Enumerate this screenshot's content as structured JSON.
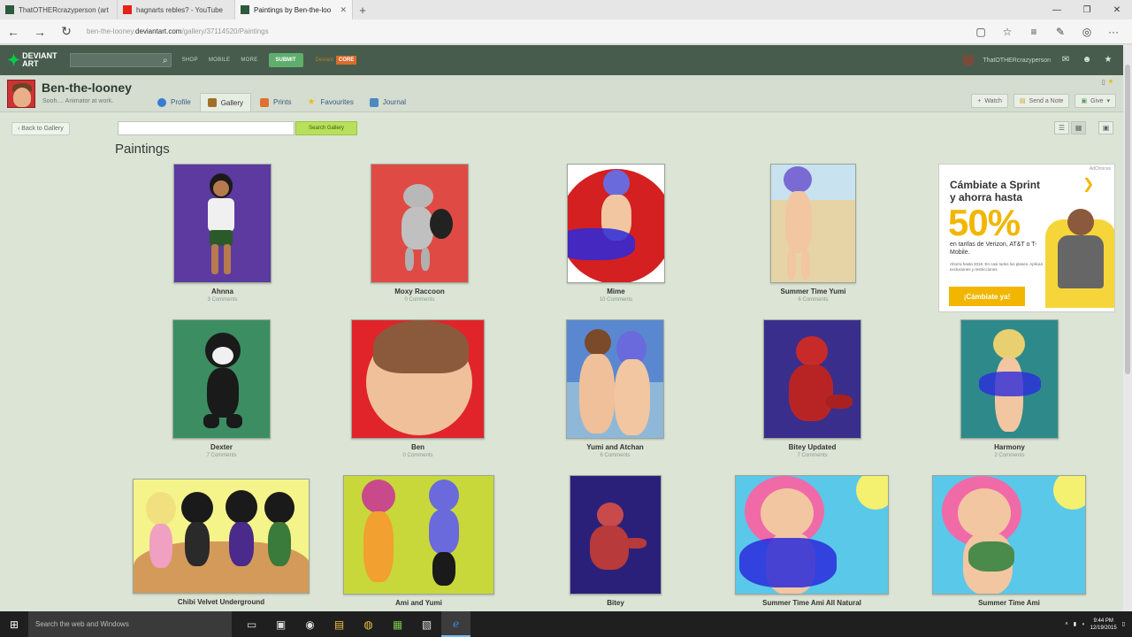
{
  "browser": {
    "tabs": [
      {
        "label": "ThatOTHERcrazyperson (art",
        "favicon_color": "#2d5a3c",
        "active": false
      },
      {
        "label": "hagnarts rebles? - YouTube",
        "favicon_color": "#e62117",
        "active": false
      },
      {
        "label": "Paintings by Ben-the-loo",
        "favicon_color": "#2d5a3c",
        "active": true
      }
    ],
    "new_tab": "+",
    "url_prefix": "ben-the-looney.",
    "url_domain": "deviantart.com",
    "url_suffix": "/gallery/37114520/Paintings"
  },
  "da": {
    "logo_line1": "DEVIANT",
    "logo_line2": "ART",
    "nav": [
      "SHOP",
      "MOBILE",
      "MORE"
    ],
    "submit": "SUBMIT",
    "core_prefix": "Deviant",
    "core_badge": "CORE",
    "username": "ThatOTHERcrazyperson"
  },
  "profile": {
    "name": "Ben-the-looney",
    "tagline": "Sooh.... Animator at work.",
    "tabs": [
      {
        "label": "Profile",
        "icon_color": "#3a7bd5"
      },
      {
        "label": "Gallery",
        "icon_color": "#a0702a"
      },
      {
        "label": "Prints",
        "icon_color": "#e07030"
      },
      {
        "label": "Favourites",
        "icon_color": "#e8c020"
      },
      {
        "label": "Journal",
        "icon_color": "#4a8ac0"
      }
    ],
    "actions": [
      "Watch",
      "Send a Note",
      "Give"
    ]
  },
  "gallery": {
    "back": "Back to Gallery",
    "search_btn": "Search Gallery",
    "section_title": "Paintings",
    "items": [
      {
        "title": "Ahnna",
        "comments": "3 Comments"
      },
      {
        "title": "Moxy Raccoon",
        "comments": "0 Comments"
      },
      {
        "title": "Mime",
        "comments": "10 Comments"
      },
      {
        "title": "Summer Time Yumi",
        "comments": "6 Comments"
      },
      {
        "title": "Dexter",
        "comments": "7 Comments"
      },
      {
        "title": "Ben",
        "comments": "0 Comments"
      },
      {
        "title": "Yumi and Atchan",
        "comments": "6 Comments"
      },
      {
        "title": "Bitey Updated",
        "comments": "7 Comments"
      },
      {
        "title": "Harmony",
        "comments": "2 Comments"
      },
      {
        "title": "Chibi Velvet Underground",
        "comments": ""
      },
      {
        "title": "Ami and Yumi",
        "comments": ""
      },
      {
        "title": "Bitey",
        "comments": ""
      },
      {
        "title": "Summer Time Ami All Natural",
        "comments": ""
      },
      {
        "title": "Summer Time Ami",
        "comments": ""
      }
    ]
  },
  "ad": {
    "choices": "AdChoices",
    "line1": "Cámbiate a Sprint",
    "line2": "y ahorra hasta",
    "percent": "50%",
    "sub1": "en tarifas de Verizon, AT&T o T-Mobile.",
    "sub2": "Ahorra hasta 2018. En casi todos los planes. Aplican exclusiones y restricciones.",
    "cta": "¡Cámbiate ya!",
    "brand": "Sprint"
  },
  "taskbar": {
    "search_placeholder": "Search the web and Windows",
    "time": "9:44 PM",
    "date": "12/19/2015"
  }
}
